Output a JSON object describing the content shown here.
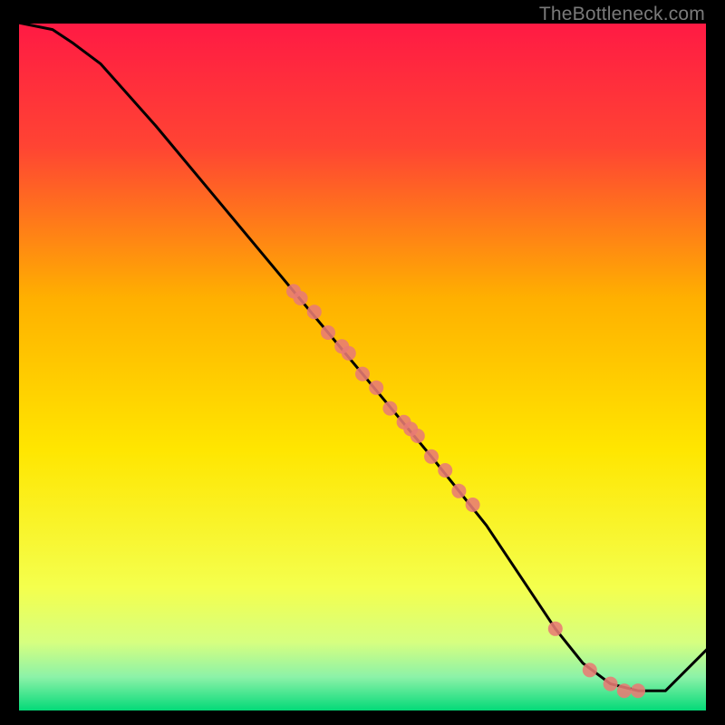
{
  "watermark": "TheBottleneck.com",
  "colors": {
    "gradient_top": "#ff1a44",
    "gradient_mid_upper": "#ffb300",
    "gradient_mid": "#ffee00",
    "gradient_low": "#e6ff66",
    "gradient_bottom": "#00e67a",
    "line": "#000000",
    "marker": "#e87b74",
    "frame": "#000000"
  },
  "chart_data": {
    "type": "line",
    "title": "",
    "xlabel": "",
    "ylabel": "",
    "xlim": [
      0,
      100
    ],
    "ylim": [
      0,
      100
    ],
    "series": [
      {
        "name": "curve",
        "x": [
          0,
          5,
          8,
          12,
          20,
          30,
          40,
          50,
          60,
          68,
          74,
          78,
          82,
          86,
          90,
          94,
          100
        ],
        "y": [
          100,
          99,
          97,
          94,
          85,
          73,
          61,
          49,
          37,
          27,
          18,
          12,
          7,
          4,
          3,
          3,
          9
        ]
      }
    ],
    "markers": {
      "name": "data-points",
      "x": [
        40,
        41,
        43,
        45,
        47,
        48,
        50,
        52,
        54,
        56,
        57,
        58,
        60,
        62,
        64,
        66,
        78,
        83,
        86,
        88,
        90
      ],
      "y": [
        61,
        60,
        58,
        55,
        53,
        52,
        49,
        47,
        44,
        42,
        41,
        40,
        37,
        35,
        32,
        30,
        12,
        6,
        4,
        3,
        3
      ]
    }
  }
}
